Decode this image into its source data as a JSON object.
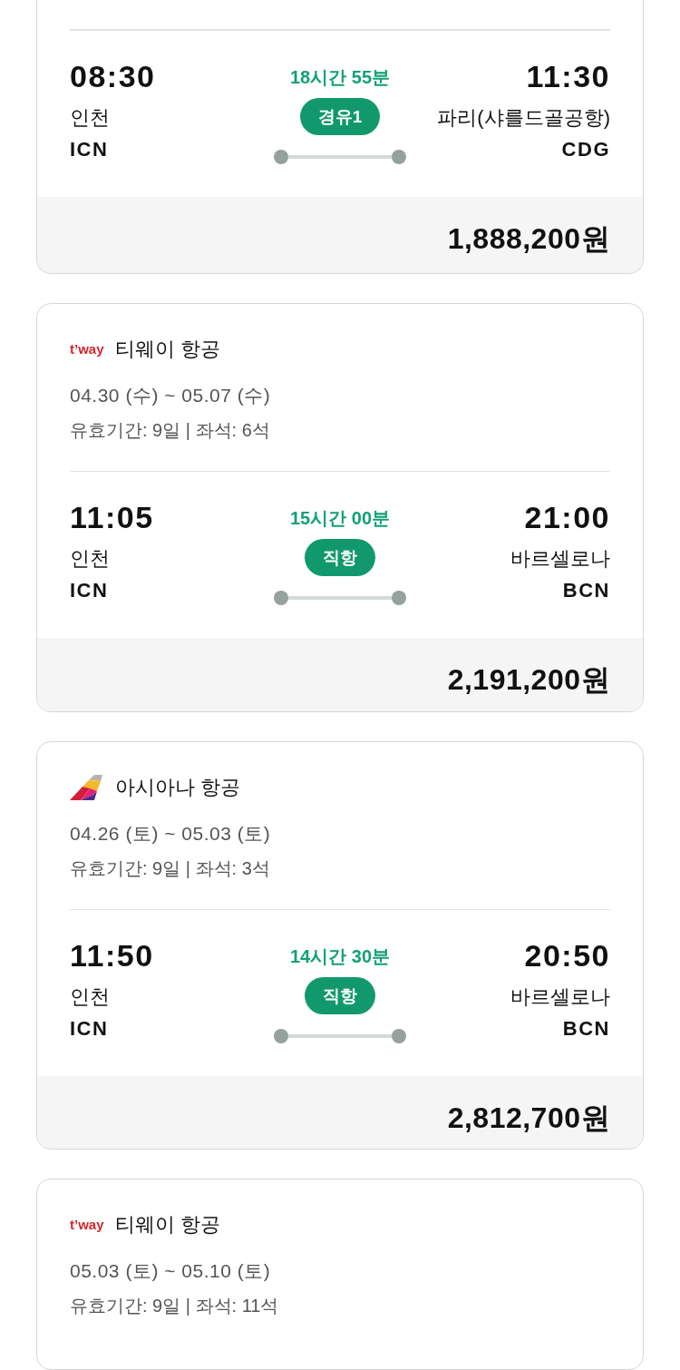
{
  "results": [
    {
      "route": {
        "departure": {
          "time": "08:30",
          "city": "인천",
          "code": "ICN"
        },
        "duration": "18시간 55분",
        "stops": "경유1",
        "arrival": {
          "time": "11:30",
          "city": "파리(샤를드골공항)",
          "code": "CDG"
        }
      },
      "price": "1,888,200원"
    },
    {
      "airline": {
        "logo": {
          "kind": "wordmark",
          "text": "t’way"
        },
        "name": "티웨이 항공"
      },
      "dates": "04.30 (수) ~ 05.07 (수)",
      "details": "유효기간: 9일 | 좌석: 6석",
      "route": {
        "departure": {
          "time": "11:05",
          "city": "인천",
          "code": "ICN"
        },
        "duration": "15시간 00분",
        "stops": "직항",
        "arrival": {
          "time": "21:00",
          "city": "바르셀로나",
          "code": "BCN"
        }
      },
      "price": "2,191,200원"
    },
    {
      "airline": {
        "logo": {
          "kind": "tail"
        },
        "name": "아시아나 항공"
      },
      "dates": "04.26 (토) ~ 05.03 (토)",
      "details": "유효기간: 9일 | 좌석: 3석",
      "route": {
        "departure": {
          "time": "11:50",
          "city": "인천",
          "code": "ICN"
        },
        "duration": "14시간 30분",
        "stops": "직항",
        "arrival": {
          "time": "20:50",
          "city": "바르셀로나",
          "code": "BCN"
        }
      },
      "price": "2,812,700원"
    },
    {
      "airline": {
        "logo": {
          "kind": "wordmark",
          "text": "t’way"
        },
        "name": "티웨이 항공"
      },
      "dates": "05.03 (토) ~ 05.10 (토)",
      "details": "유효기간: 9일 | 좌석: 11석"
    }
  ]
}
